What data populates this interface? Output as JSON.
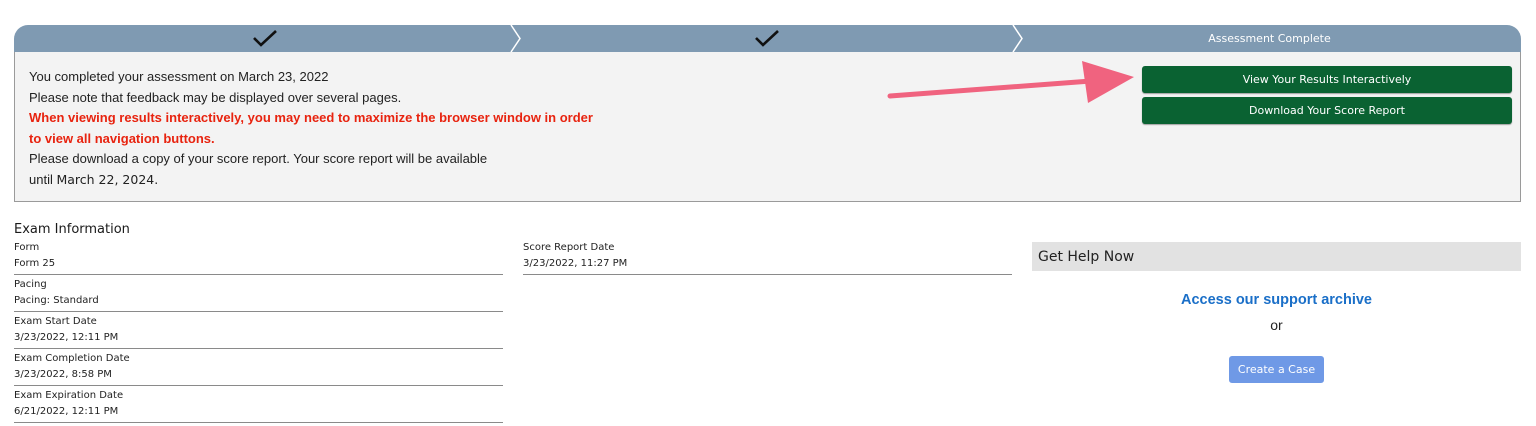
{
  "progress": {
    "steps": [
      {
        "label": "",
        "state": "complete"
      },
      {
        "label": "",
        "state": "complete"
      },
      {
        "label": "Assessment Complete",
        "state": "current"
      }
    ],
    "check_icon": "check-icon"
  },
  "status": {
    "line1": "You completed your assessment on March 23, 2022",
    "line2": "Please note that feedback may be displayed over several pages.",
    "warning1": "When viewing results interactively, you may need to maximize the browser window in order",
    "warning2": "to view all navigation buttons.",
    "line3": "Please download a copy of your score report. Your score report will be available",
    "line4_prefix": "until",
    "line4_date": "March 22, 2024.",
    "view_button": "View Your Results Interactively",
    "download_button": "Download Your Score Report"
  },
  "exam": {
    "title": "Exam Information",
    "fields_left": [
      {
        "label": "Form",
        "value": "Form 25"
      },
      {
        "label": "Pacing",
        "value": "Pacing: Standard"
      },
      {
        "label": "Exam Start Date",
        "value": "3/23/2022, 12:11 PM"
      },
      {
        "label": "Exam Completion Date",
        "value": "3/23/2022, 8:58 PM"
      },
      {
        "label": "Exam Expiration Date",
        "value": "6/21/2022, 12:11 PM"
      }
    ],
    "fields_mid": [
      {
        "label": "Score Report Date",
        "value": "3/23/2022, 11:27 PM"
      }
    ]
  },
  "help": {
    "header": "Get Help Now",
    "link": "Access our support archive",
    "or": "or",
    "case_button": "Create a Case"
  },
  "colors": {
    "progress_bar": "#7f9ab2",
    "button_green": "#0a6232",
    "warning_red": "#e8230f",
    "link_blue": "#1a6fc8",
    "case_button": "#6f99e6",
    "annotation_arrow": "#f0637f"
  }
}
